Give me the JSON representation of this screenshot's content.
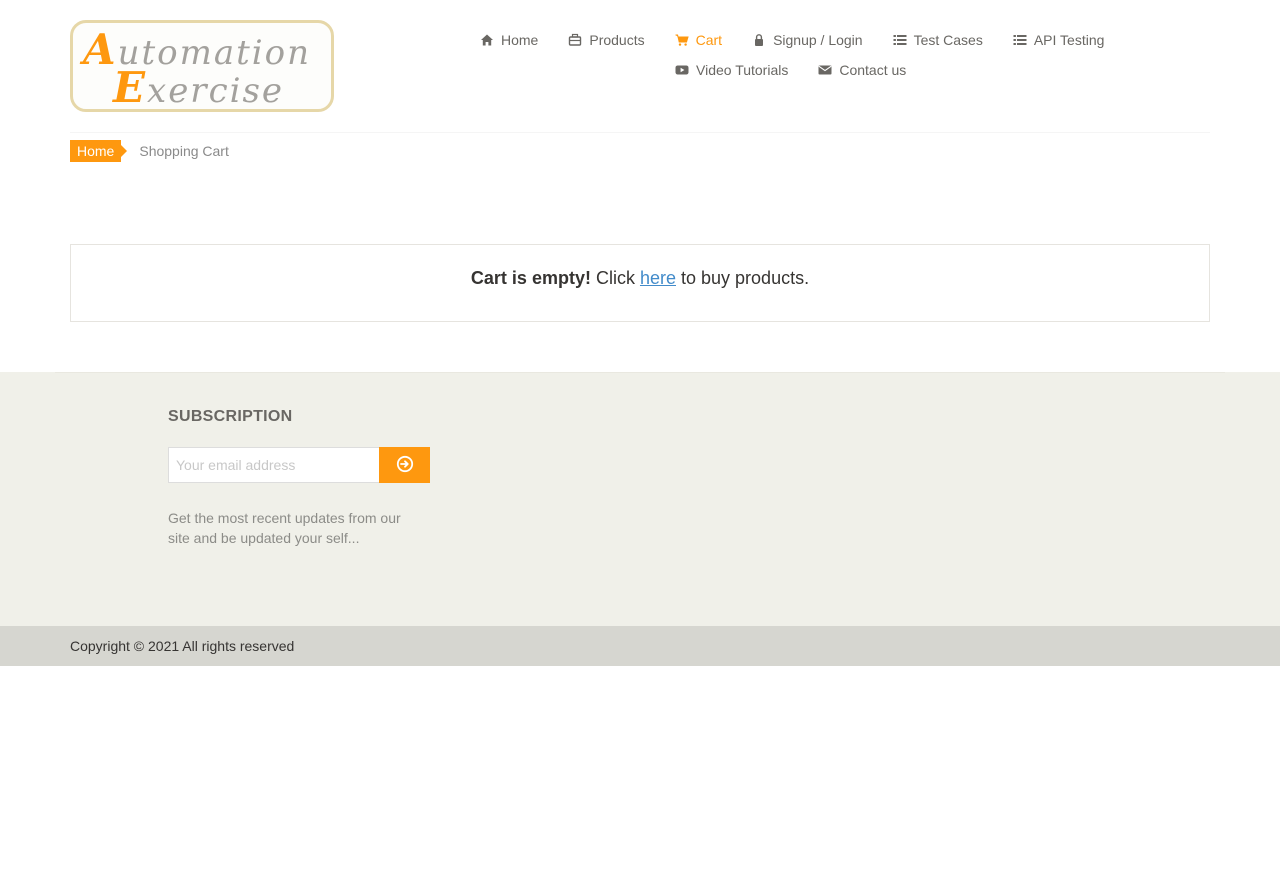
{
  "logo": {
    "line1_cap": "A",
    "line1_rest": "utomation",
    "line2_cap": "E",
    "line2_rest": "xercise"
  },
  "nav": {
    "items": [
      {
        "label": "Home",
        "icon": "home-icon"
      },
      {
        "label": "Products",
        "icon": "products-icon"
      },
      {
        "label": "Cart",
        "icon": "cart-icon",
        "active": true
      },
      {
        "label": "Signup / Login",
        "icon": "lock-icon"
      },
      {
        "label": "Test Cases",
        "icon": "list-icon"
      },
      {
        "label": "API Testing",
        "icon": "list-icon"
      },
      {
        "label": "Video Tutorials",
        "icon": "youtube-play-icon"
      },
      {
        "label": "Contact us",
        "icon": "envelope-icon"
      }
    ]
  },
  "breadcrumb": {
    "home": "Home",
    "current": "Shopping Cart"
  },
  "cart": {
    "empty_bold": "Cart is empty!",
    "before_link": " Click ",
    "link_text": "here",
    "after_link": " to buy products."
  },
  "footer": {
    "subscription_title": "SUBSCRIPTION",
    "email_placeholder": "Your email address",
    "subscribe_icon": "arrow-circle-right-icon",
    "subscription_text": "Get the most recent updates from our site and be updated your self...",
    "copyright": "Copyright © 2021 All rights reserved"
  },
  "colors": {
    "accent": "#fe980f",
    "footer_bg": "#f0f0e9",
    "footer_bottom_bg": "#d6d6d0",
    "link": "#428bca"
  }
}
